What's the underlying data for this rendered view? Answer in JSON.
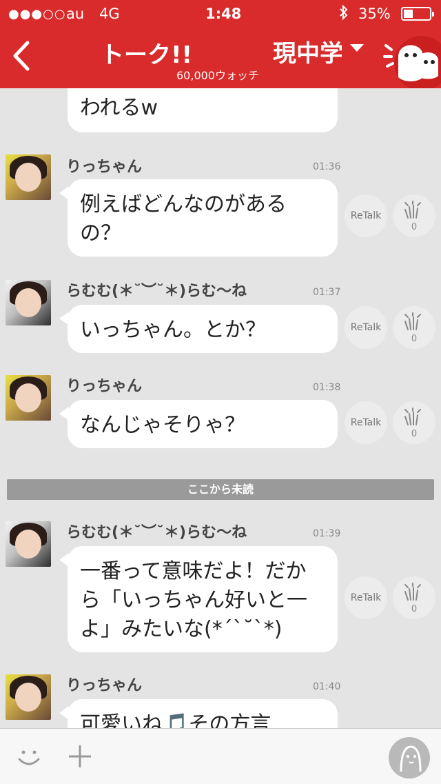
{
  "status_bar": {
    "signal": "●●●○○",
    "carrier": "au",
    "network": "4G",
    "time": "1:48",
    "battery": "35%",
    "battery_level": 0.35
  },
  "header": {
    "title": "トーク!!",
    "watch_count": "60,000ウォッチ",
    "channel": "現中学"
  },
  "messages": [
    {
      "author": "",
      "time": "",
      "text": "われるw",
      "retalk": "",
      "claps": ""
    },
    {
      "author": "りっちゃん",
      "time": "01:36",
      "text": "例えばどんなのがあるの？",
      "retalk": "ReTalk",
      "claps": "0"
    },
    {
      "author": "らむむ(＊˘︶˘＊)らむ〜ね",
      "time": "01:37",
      "text": "いっちゃん。とか？",
      "retalk": "ReTalk",
      "claps": "0"
    },
    {
      "author": "りっちゃん",
      "time": "01:38",
      "text": "なんじゃそりゃ？",
      "retalk": "ReTalk",
      "claps": "0"
    },
    {
      "author": "らむむ(＊˘︶˘＊)らむ〜ね",
      "time": "01:39",
      "text": "一番って意味だよ！だから「いっちゃん好いと一よ」みたいな(*´`˘`*)",
      "retalk": "ReTalk",
      "claps": "0"
    },
    {
      "author": "りっちゃん",
      "time": "01:40",
      "text": "可愛いね🎵その方言",
      "retalk": "",
      "claps": ""
    }
  ],
  "unread_divider": "ここから未読",
  "colors": {
    "header": "#d92b2b",
    "background": "#e4e4e4",
    "bubble": "#ffffff"
  },
  "icons": [
    "back-chevron-icon",
    "dropdown-icon",
    "mascot-icon",
    "clap-icon",
    "smiley-icon",
    "plus-icon",
    "profile-icon",
    "bluetooth-icon",
    "battery-icon"
  ]
}
